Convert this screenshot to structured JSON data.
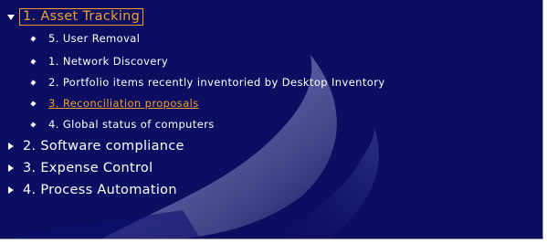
{
  "colors": {
    "background": "#0b0e61",
    "text": "#ffffff",
    "selected": "#f0a030"
  },
  "tree": {
    "root": {
      "label": "1. Asset Tracking",
      "expanded": true,
      "selected": true,
      "icon": "expanded-arrow-icon"
    },
    "children": [
      {
        "label": "5. User Removal",
        "icon": "bullet-icon"
      },
      {
        "label": "1. Network Discovery",
        "icon": "bullet-icon"
      },
      {
        "label": "2. Portfolio items recently inventoried by Desktop Inventory",
        "icon": "bullet-icon"
      },
      {
        "label": "3. Reconciliation proposals",
        "icon": "bullet-icon",
        "active": true
      },
      {
        "label": "4. Global status of computers",
        "icon": "bullet-icon"
      }
    ],
    "collapsed": [
      {
        "label": "2. Software compliance",
        "icon": "collapsed-arrow-icon"
      },
      {
        "label": "3. Expense Control",
        "icon": "collapsed-arrow-icon"
      },
      {
        "label": "4. Process Automation",
        "icon": "collapsed-arrow-icon"
      }
    ]
  }
}
